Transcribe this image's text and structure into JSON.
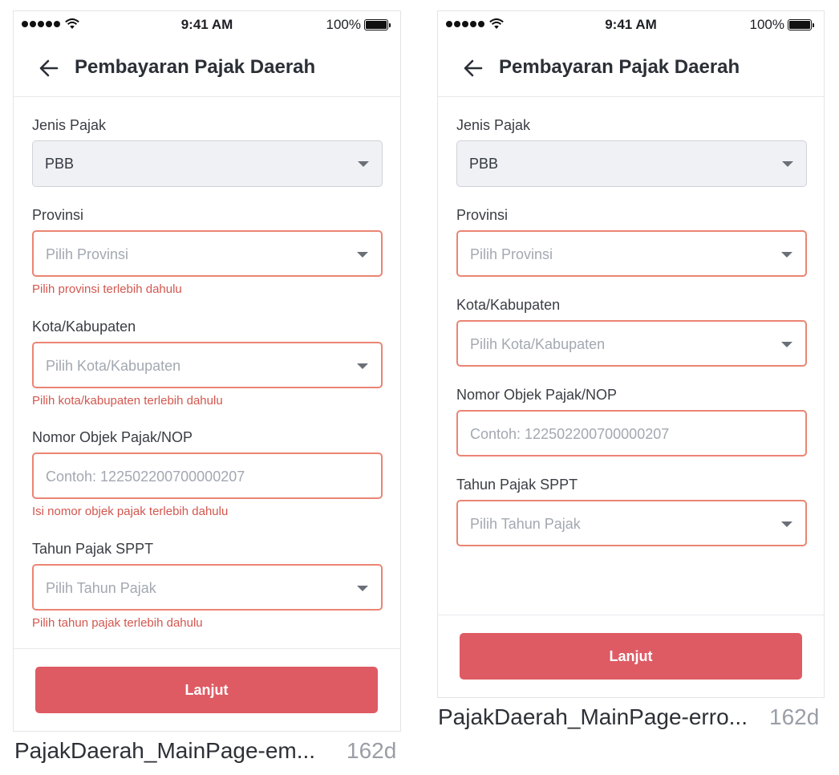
{
  "status_bar": {
    "time": "9:41 AM",
    "battery": "100%"
  },
  "screens": [
    {
      "title": "Pembayaran Pajak Daerah",
      "fields": [
        {
          "label": "Jenis Pajak",
          "value": "PBB"
        },
        {
          "label": "Provinsi",
          "placeholder": "Pilih Provinsi",
          "error": "Pilih provinsi terlebih dahulu"
        },
        {
          "label": "Kota/Kabupaten",
          "placeholder": "Pilih Kota/Kabupaten",
          "error": "Pilih kota/kabupaten terlebih dahulu"
        },
        {
          "label": "Nomor Objek Pajak/NOP",
          "placeholder": "Contoh: 122502200700000207",
          "error": "Isi nomor objek pajak terlebih dahulu"
        },
        {
          "label": "Tahun Pajak SPPT",
          "placeholder": "Pilih Tahun Pajak",
          "error": "Pilih tahun pajak terlebih dahulu"
        }
      ],
      "button": "Lanjut",
      "caption": "PajakDaerah_MainPage-em...",
      "caption_age": "162d"
    },
    {
      "title": "Pembayaran Pajak Daerah",
      "fields": [
        {
          "label": "Jenis Pajak",
          "value": "PBB"
        },
        {
          "label": "Provinsi",
          "placeholder": "Pilih Provinsi"
        },
        {
          "label": "Kota/Kabupaten",
          "placeholder": "Pilih Kota/Kabupaten"
        },
        {
          "label": "Nomor Objek Pajak/NOP",
          "placeholder": "Contoh: 122502200700000207"
        },
        {
          "label": "Tahun Pajak SPPT",
          "placeholder": "Pilih Tahun Pajak"
        }
      ],
      "button": "Lanjut",
      "caption": "PajakDaerah_MainPage-erro...",
      "caption_age": "162d"
    }
  ]
}
